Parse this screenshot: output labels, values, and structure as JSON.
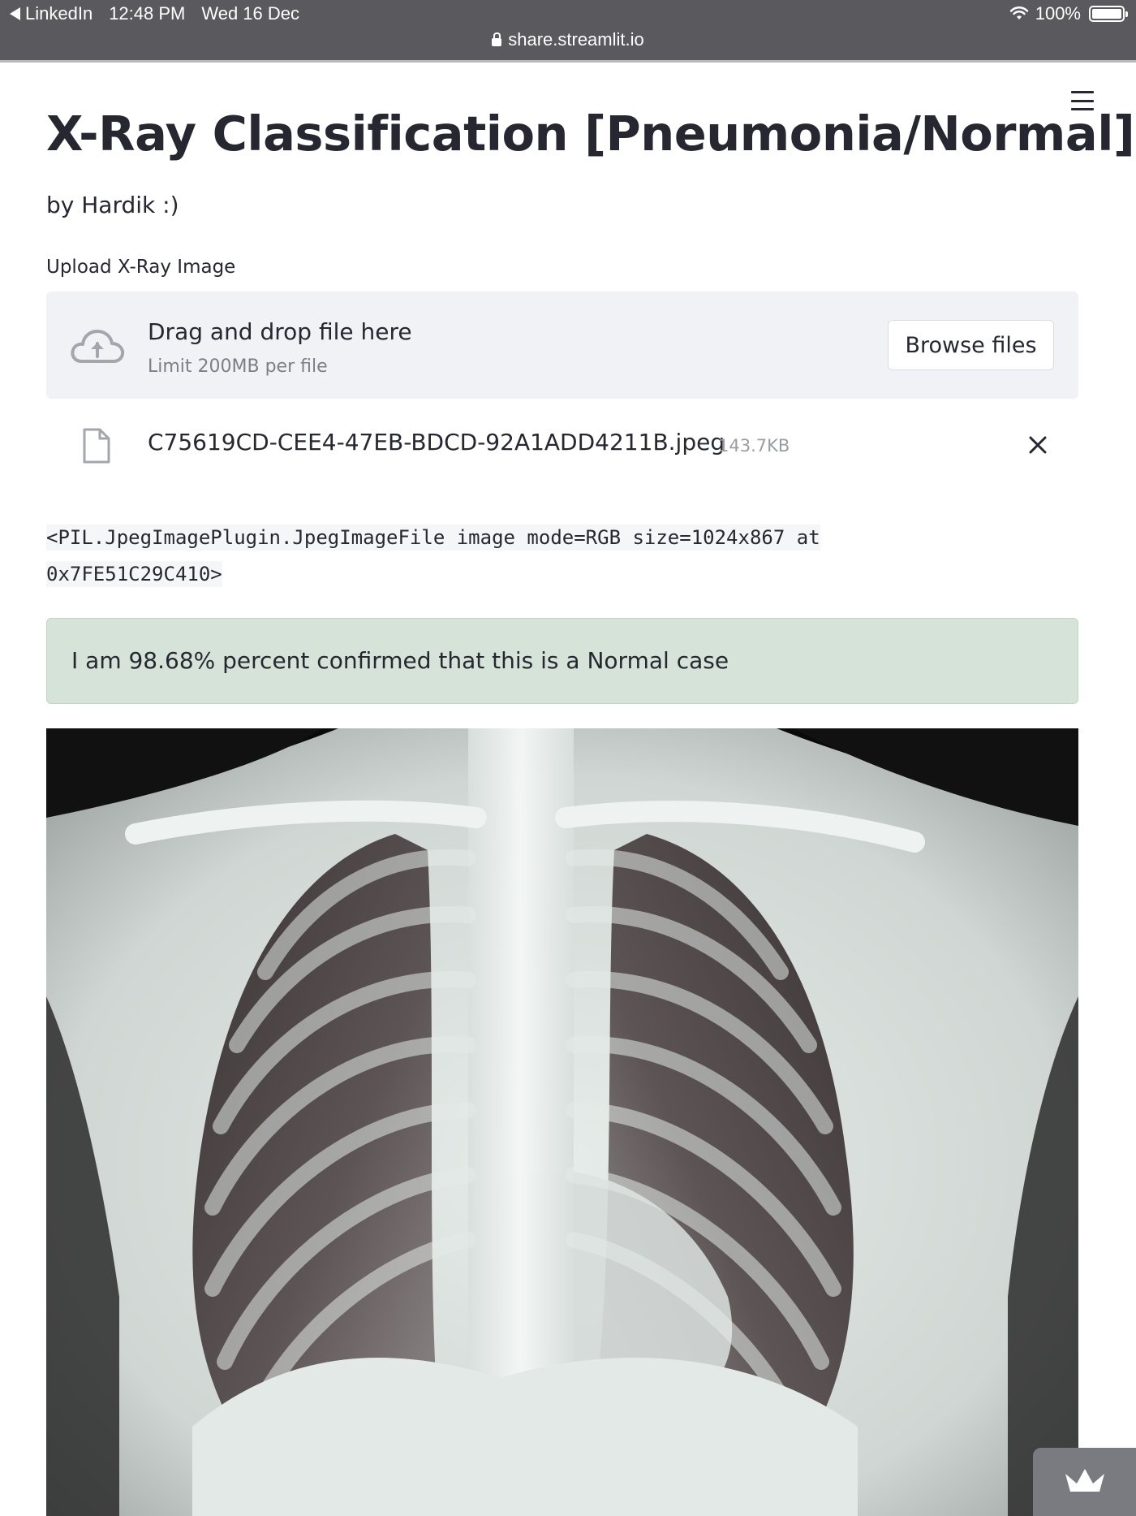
{
  "status_bar": {
    "back_app": "LinkedIn",
    "time": "12:48 PM",
    "date": "Wed 16 Dec",
    "battery": "100%",
    "url": "share.streamlit.io"
  },
  "icons": {
    "menu": "hamburger-menu-icon",
    "upload": "cloud-upload-icon",
    "file": "file-icon",
    "remove": "close-icon",
    "wifi": "wifi-icon",
    "lock": "lock-icon",
    "badge": "streamlit-crown-icon"
  },
  "app": {
    "title": "X-Ray Classification [Pneumonia/Normal]",
    "author": "by Hardik :)"
  },
  "uploader": {
    "label": "Upload X-Ray Image",
    "drop_text": "Drag and drop file here",
    "limit_text": "Limit 200MB per file",
    "browse_label": "Browse files",
    "file_name": "C75619CD-CEE4-47EB-BDCD-92A1ADD4211B.jpeg",
    "file_size": "143.7KB"
  },
  "output": {
    "code_line_1": "<PIL.JpegImagePlugin.JpegImageFile image mode=RGB size=1024x867 at",
    "code_line_2": "0x7FE51C29C410>",
    "result": "I am 98.68% percent confirmed that this is a Normal case"
  },
  "colors": {
    "status_bar_bg": "#5a5a5e",
    "dropzone_bg": "#f0f2f6",
    "success_bg": "#d6e3d8",
    "text": "#262730"
  }
}
